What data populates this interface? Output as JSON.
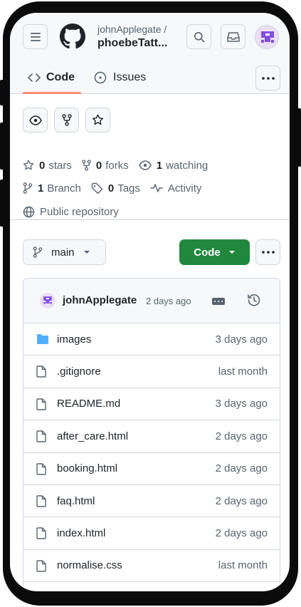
{
  "header": {
    "owner": "johnApplegate /",
    "repo_name": "phoebeTatt...",
    "icons": [
      "menu-icon",
      "github-logo-icon",
      "search-icon",
      "inbox-icon",
      "avatar"
    ]
  },
  "tabs": [
    {
      "label": "Code",
      "icon": "code-icon",
      "active": true
    },
    {
      "label": "Issues",
      "icon": "issue-icon",
      "active": false
    }
  ],
  "stats": {
    "stars_count": "0",
    "stars_label": "stars",
    "forks_count": "0",
    "forks_label": "forks",
    "watching_count": "1",
    "watching_label": "watching",
    "branch_count": "1",
    "branch_label": "Branch",
    "tags_count": "0",
    "tags_label": "Tags",
    "activity_label": "Activity",
    "visibility_label": "Public repository"
  },
  "branch": {
    "name": "main",
    "code_button_label": "Code"
  },
  "last_commit": {
    "author": "johnApplegate",
    "time": "2 days ago"
  },
  "files": [
    {
      "name": "images",
      "time": "3 days ago",
      "type": "folder"
    },
    {
      "name": ".gitignore",
      "time": "last month",
      "type": "file"
    },
    {
      "name": "README.md",
      "time": "3 days ago",
      "type": "file"
    },
    {
      "name": "after_care.html",
      "time": "2 days ago",
      "type": "file"
    },
    {
      "name": "booking.html",
      "time": "2 days ago",
      "type": "file"
    },
    {
      "name": "faq.html",
      "time": "2 days ago",
      "type": "file"
    },
    {
      "name": "index.html",
      "time": "2 days ago",
      "type": "file"
    },
    {
      "name": "normalise.css",
      "time": "last month",
      "type": "file"
    }
  ],
  "colors": {
    "accent_green": "#1f883d",
    "tab_underline": "#fd8c73",
    "folder_blue": "#54aeff",
    "avatar_purple": "#8250df"
  }
}
